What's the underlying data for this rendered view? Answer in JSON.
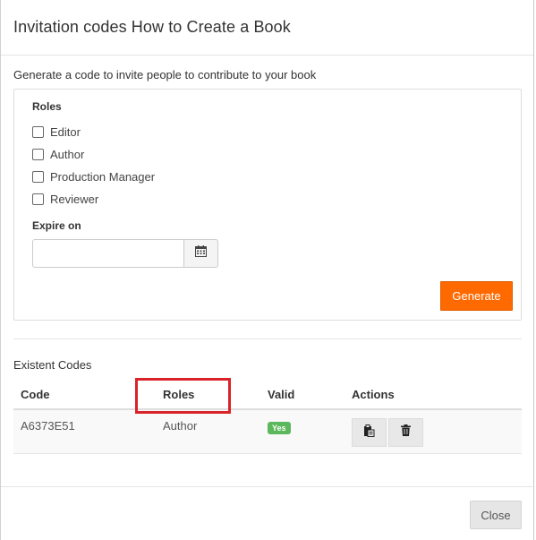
{
  "dialog": {
    "title": "Invitation codes How to Create a Book",
    "intro": "Generate a code to invite people to contribute to your book"
  },
  "form": {
    "roles_label": "Roles",
    "roles": [
      {
        "label": "Editor",
        "checked": false
      },
      {
        "label": "Author",
        "checked": false
      },
      {
        "label": "Production Manager",
        "checked": false
      },
      {
        "label": "Reviewer",
        "checked": false
      }
    ],
    "expire_label": "Expire on",
    "expire_value": "",
    "calendar_icon": "calendar-icon",
    "generate_label": "Generate"
  },
  "codes": {
    "section_label": "Existent Codes",
    "columns": [
      "Code",
      "Roles",
      "Valid",
      "Actions"
    ],
    "rows": [
      {
        "code": "A6373E51",
        "roles": "Author",
        "valid": "Yes",
        "actions": [
          "clipboard-icon",
          "trash-icon"
        ]
      }
    ]
  },
  "footer": {
    "close_label": "Close"
  },
  "colors": {
    "accent": "#ff6a00",
    "valid_badge": "#5cb85c",
    "highlight": "#d8232a"
  }
}
